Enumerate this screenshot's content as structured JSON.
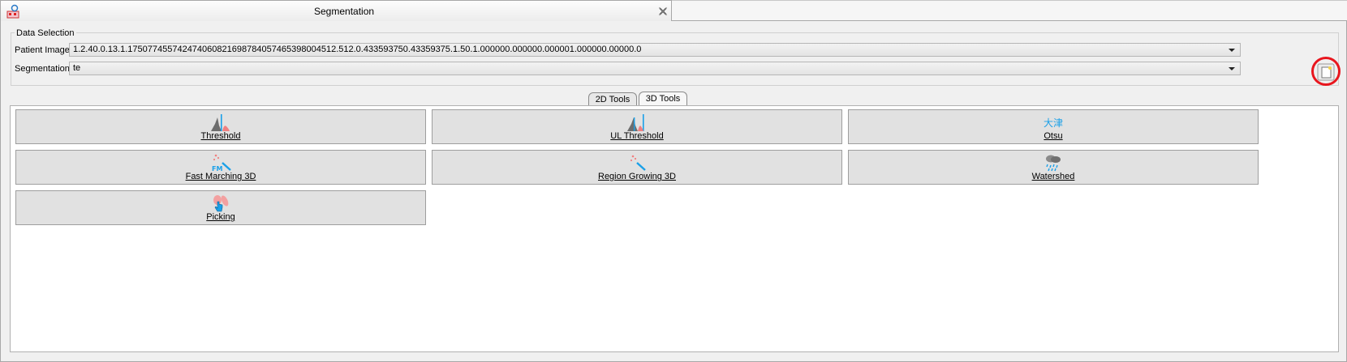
{
  "window": {
    "title": "Segmentation"
  },
  "data_selection": {
    "group_title": "Data Selection",
    "patient_image_label": "Patient Image",
    "patient_image_value": "1.2.40.0.13.1.175077455742474060821698784057465398004512.512.0.433593750.43359375.1.50.1.000000.000000.000001.000000.00000.0",
    "segmentation_label": "Segmentation",
    "segmentation_value": "te"
  },
  "tabs": [
    {
      "label": "2D Tools",
      "active": false
    },
    {
      "label": "3D Tools",
      "active": true
    }
  ],
  "tools": [
    {
      "label": "Threshold",
      "icon": "threshold-icon"
    },
    {
      "label": "UL Threshold",
      "icon": "ul-threshold-icon"
    },
    {
      "label": "Otsu",
      "icon": "otsu-icon",
      "icon_text": "大津"
    },
    {
      "label": "Fast Marching 3D",
      "icon": "fast-marching-icon",
      "icon_text": "FM"
    },
    {
      "label": "Region Growing 3D",
      "icon": "region-growing-icon"
    },
    {
      "label": "Watershed",
      "icon": "watershed-icon"
    },
    {
      "label": "Picking",
      "icon": "picking-icon"
    }
  ],
  "colors": {
    "accent": "#1aa0e8",
    "pink": "#f08080",
    "highlight_ring": "#e8161e"
  }
}
